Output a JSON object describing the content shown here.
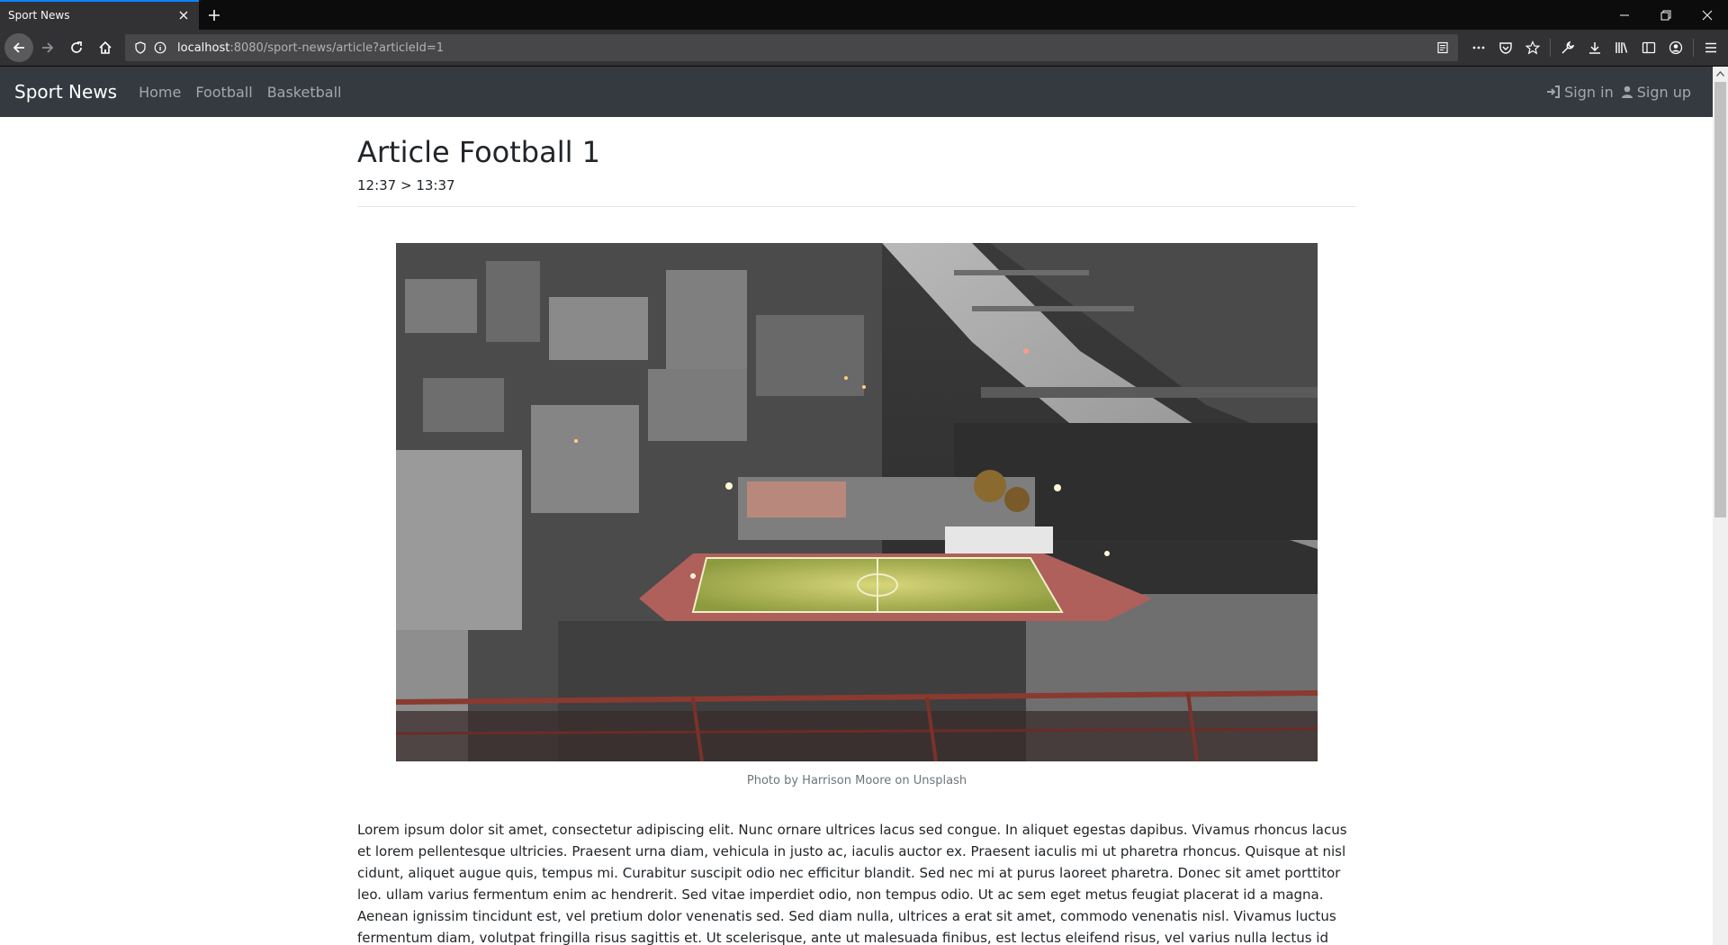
{
  "browser": {
    "tab_title": "Sport News",
    "url_host": "localhost",
    "url_rest": ":8080/sport-news/article?articleId=1",
    "accent_color": "#0a84ff"
  },
  "site": {
    "brand": "Sport News",
    "nav": [
      {
        "label": "Home"
      },
      {
        "label": "Football"
      },
      {
        "label": "Basketball"
      }
    ],
    "sign_in": "Sign in",
    "sign_up": "Sign up",
    "nav_bg_color": "#343a40"
  },
  "article": {
    "title": "Article Football 1",
    "time": "12:37 > 13:37",
    "image_caption": "Photo by Harrison Moore on Unsplash",
    "body": "Lorem ipsum dolor sit amet, consectetur adipiscing elit. Nunc ornare ultrices lacus sed congue. In aliquet egestas dapibus. Vivamus rhoncus lacus et lorem pellentesque ultricies. Praesent urna diam, vehicula in justo ac, iaculis auctor ex. Praesent iaculis mi ut pharetra rhoncus. Quisque at nisl cidunt, aliquet augue quis, tempus mi. Curabitur suscipit odio nec efficitur blandit. Sed nec mi at purus laoreet pharetra. Donec sit amet porttitor leo. ullam varius fermentum enim ac hendrerit. Sed vitae imperdiet odio, non tempus odio. Ut ac sem eget metus feugiat placerat id a magna. Aenean ignissim tincidunt est, vel pretium dolor venenatis sed. Sed diam nulla, ultrices a erat sit amet, commodo venenatis nisl. Vivamus luctus fermentum diam, volutpat fringilla risus sagittis et. Ut scelerisque, ante ut malesuada finibus, est lectus eleifend risus, vel varius nulla lectus id metus. Sed in turpis sit amet tortor laoreet euismod at non tortor. Ut"
  }
}
